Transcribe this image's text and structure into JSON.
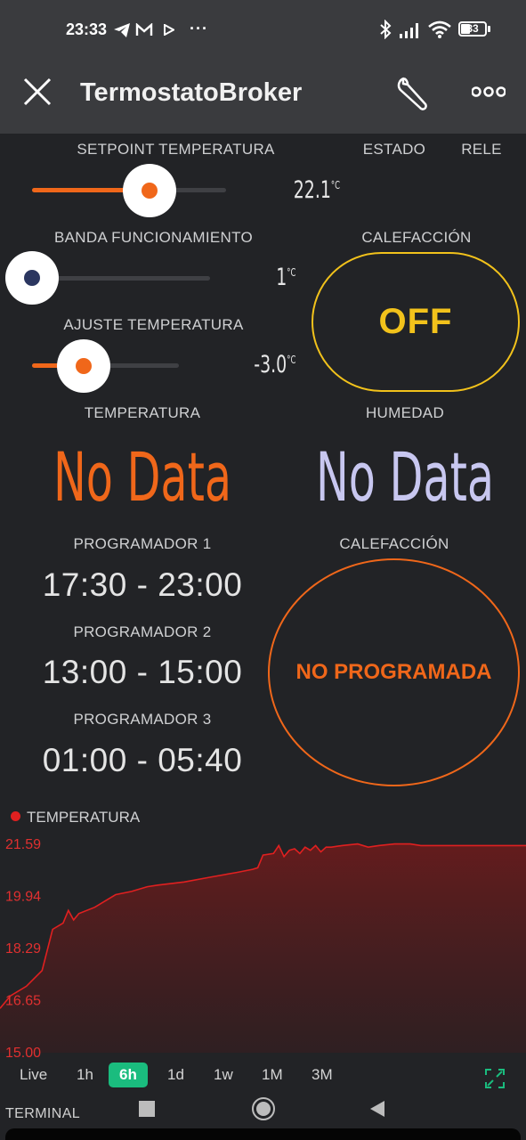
{
  "status_bar": {
    "time": "23:33",
    "battery": "33",
    "more": "···"
  },
  "app_bar": {
    "title": "TermostatoBroker"
  },
  "setpoint": {
    "label": "SETPOINT TEMPERATURA",
    "value": "22.1",
    "unit": "°C",
    "level": 0.61,
    "color": "#f0671a"
  },
  "banda": {
    "label": "BANDA FUNCIONAMIENTO",
    "value": "1",
    "unit": "°C",
    "level": 0.0,
    "color": "#2b3660"
  },
  "ajuste": {
    "label": "AJUSTE TEMPERATURA",
    "value": "-3.0",
    "unit": "°C",
    "level": 0.35,
    "color": "#f0671a"
  },
  "estado": {
    "label": "ESTADO"
  },
  "rele": {
    "label": "RELE"
  },
  "calefaccion_state": {
    "label": "CALEFACCIÓN",
    "button": "OFF",
    "color": "#f2c21b"
  },
  "temperatura": {
    "label": "TEMPERATURA",
    "value": "No Data",
    "color": "#f0671a"
  },
  "humedad": {
    "label": "HUMEDAD",
    "value": "No Data",
    "color": "#c8c7f0"
  },
  "programadores": [
    {
      "label": "PROGRAMADOR 1",
      "value": "17:30 - 23:00"
    },
    {
      "label": "PROGRAMADOR 2",
      "value": "13:00 - 15:00"
    },
    {
      "label": "PROGRAMADOR 3",
      "value": "01:00 - 05:40"
    }
  ],
  "calefaccion_program": {
    "label": "CALEFACCIÓN",
    "button": "NO PROGRAMADA",
    "color": "#f0671a"
  },
  "chart_data": {
    "type": "area",
    "series": [
      {
        "name": "TEMPERATURA",
        "color": "#e02020",
        "x": [
          0,
          2,
          5,
          8,
          10,
          12,
          13,
          14,
          15,
          18,
          20,
          22,
          25,
          28,
          30,
          35,
          40,
          45,
          48,
          49,
          50,
          52,
          53,
          54,
          55,
          56,
          57,
          58,
          59,
          60,
          61,
          62,
          63,
          65,
          68,
          70,
          72,
          75,
          78,
          80,
          85,
          88,
          90,
          95,
          100
        ],
        "values": [
          16.4,
          16.8,
          17.1,
          17.6,
          18.9,
          19.1,
          19.5,
          19.2,
          19.4,
          19.6,
          19.8,
          20.0,
          20.1,
          20.25,
          20.3,
          20.4,
          20.55,
          20.7,
          20.8,
          20.85,
          21.25,
          21.3,
          21.55,
          21.2,
          21.4,
          21.45,
          21.3,
          21.5,
          21.4,
          21.55,
          21.35,
          21.5,
          21.5,
          21.55,
          21.6,
          21.5,
          21.55,
          21.6,
          21.6,
          21.55,
          21.55,
          21.55,
          21.55,
          21.55,
          21.55
        ]
      }
    ],
    "yticks": [
      "21.59",
      "19.94",
      "18.29",
      "16.65",
      "15.00"
    ],
    "ylim": [
      15.0,
      21.59
    ],
    "xlim": [
      0,
      100
    ],
    "legend": "top-left",
    "grid": false
  },
  "time_filters": [
    "Live",
    "1h",
    "6h",
    "1d",
    "1w",
    "1M",
    "3M"
  ],
  "active_filter": "6h",
  "accent": "#1abc7e",
  "footer": {
    "terminal": "TERMINAL"
  }
}
